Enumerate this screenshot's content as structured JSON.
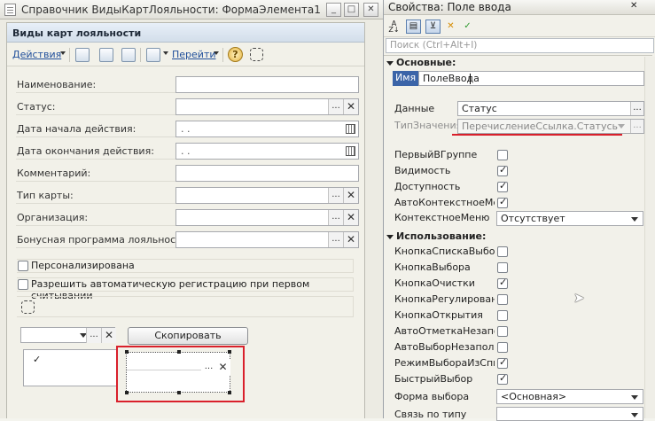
{
  "designer": {
    "window_title": "Справочник ВидыКартЛояльности: ФормаЭлемента1",
    "form_caption": "Виды карт лояльности",
    "toolbar": {
      "actions_label": "Действия",
      "goto_label": "Перейти",
      "help_label": "?"
    },
    "fields": [
      {
        "label": "Наименование:",
        "value": ""
      },
      {
        "label": "Статус:",
        "value": ""
      },
      {
        "label": "Дата начала действия:",
        "value": " .  ."
      },
      {
        "label": "Дата окончания действия:",
        "value": " .  ."
      },
      {
        "label": "Комментарий:",
        "value": ""
      },
      {
        "label": "Тип карты:",
        "value": ""
      },
      {
        "label": "Организация:",
        "value": ""
      },
      {
        "label": "Бонусная программа лояльности:",
        "value": ""
      }
    ],
    "checkboxes": [
      {
        "label": "Персонализирована",
        "checked": false
      },
      {
        "label": "Разрешить автоматическую регистрацию при первом считывании",
        "checked": false
      }
    ],
    "copy_button_label": "Скопировать",
    "close_symbol": "✕",
    "ellipsis_symbol": "...",
    "list_check_symbol": "✓",
    "selection_highlight_color": "#d9202b"
  },
  "properties": {
    "window_title": "Свойства: Поле ввода",
    "search_placeholder": "Поиск (Ctrl+Alt+I)",
    "groups": {
      "basic": "Основные:",
      "usage": "Использование:"
    },
    "name_label": "Имя",
    "name_value": "ПолеВвода",
    "data_label": "Данные",
    "data_value": "Статус",
    "type_label": "ТипЗначения",
    "type_value": "ПеречислениеСсылка.СтатусыВид",
    "basic_items": [
      {
        "label": "ПервыйВГруппе",
        "checked": false
      },
      {
        "label": "Видимость",
        "checked": true
      },
      {
        "label": "Доступность",
        "checked": true
      },
      {
        "label": "АвтоКонтекстноеМеню",
        "checked": true
      }
    ],
    "context_menu_label": "КонтекстноеМеню",
    "context_menu_value": "Отсутствует",
    "usage_items": [
      {
        "label": "КнопкаСпискаВыбора",
        "checked": false
      },
      {
        "label": "КнопкаВыбора",
        "checked": false
      },
      {
        "label": "КнопкаОчистки",
        "checked": true
      },
      {
        "label": "КнопкаРегулирования",
        "checked": false
      },
      {
        "label": "КнопкаОткрытия",
        "checked": false
      },
      {
        "label": "АвтоОтметкаНезаполненного",
        "checked": false
      },
      {
        "label": "АвтоВыборНезаполненного",
        "checked": false
      },
      {
        "label": "РежимВыбораИзСписка",
        "checked": true
      },
      {
        "label": "БыстрыйВыбор",
        "checked": true
      }
    ],
    "choice_form_label": "Форма выбора",
    "choice_form_value": "<Основная>",
    "type_link_label": "Связь по типу",
    "type_underline_color": "#d9202b"
  }
}
